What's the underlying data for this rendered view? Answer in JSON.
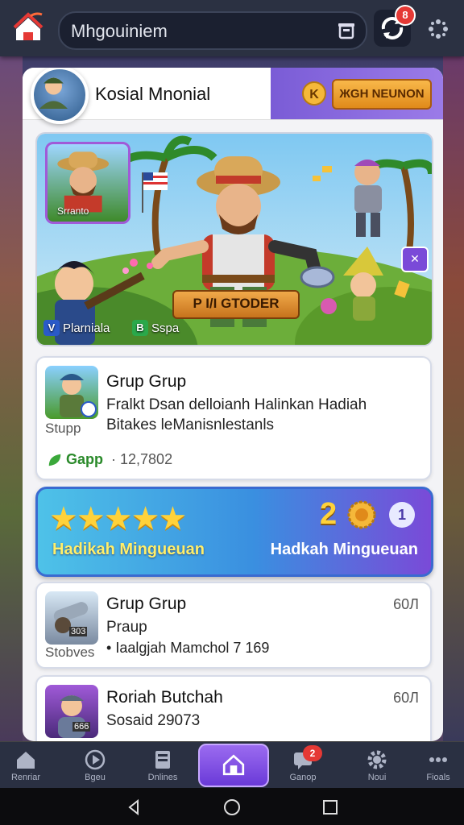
{
  "topbar": {
    "search_text": "Mhgouiniem",
    "sync_badge": "8"
  },
  "profile": {
    "name": "Kosial Mnonial",
    "coin_button": "ЖGH NEUNON"
  },
  "hero": {
    "card_label": "Srranto",
    "center_label": "P I/I GTODER",
    "chip_left_label": "Plarniala",
    "chip_left_icon": "V",
    "chip_right_label": "Sspa",
    "chip_right_icon": "B"
  },
  "card1": {
    "title": "Grup Grup",
    "desc": "Fralkt Dsan delloianh Halinkan Hadiah Bitakes leManisnlestanls",
    "sub": "Stupp",
    "app_label": "Gapp",
    "meta": "· 12,7802"
  },
  "rating": {
    "stars": "★★★★★",
    "left_label": "Hadikah Mingueuan",
    "right_label": "Hadkah Mingueuan",
    "count": "2",
    "circle": "1"
  },
  "card2": {
    "title": "Grup Grup",
    "desc": "Praup",
    "meta_line": "Iaalgjah Mamchol 7 169",
    "sub": "Stobves",
    "thumb_badge": "303",
    "right_meta": "60Л"
  },
  "card3": {
    "title": "Roriah Butchah",
    "desc": "Sosaid 29073",
    "thumb_badge": "666",
    "right_meta": "60Л"
  },
  "nav": {
    "items": [
      {
        "label": "Renriar",
        "icon": "home-icon"
      },
      {
        "label": "Bgeu",
        "icon": "play-icon"
      },
      {
        "label": "Dnlines",
        "icon": "book-icon"
      },
      {
        "label": "",
        "icon": "home-active-icon"
      },
      {
        "label": "Ganop",
        "icon": "chat-icon",
        "badge": "2"
      },
      {
        "label": "Noui",
        "icon": "gear-icon"
      },
      {
        "label": "Fioals",
        "icon": "more-icon"
      }
    ]
  },
  "colors": {
    "accent_purple": "#7a4ad8",
    "star_yellow": "#ffd23a",
    "coin_orange": "#e08a1a",
    "badge_red": "#e53935"
  }
}
